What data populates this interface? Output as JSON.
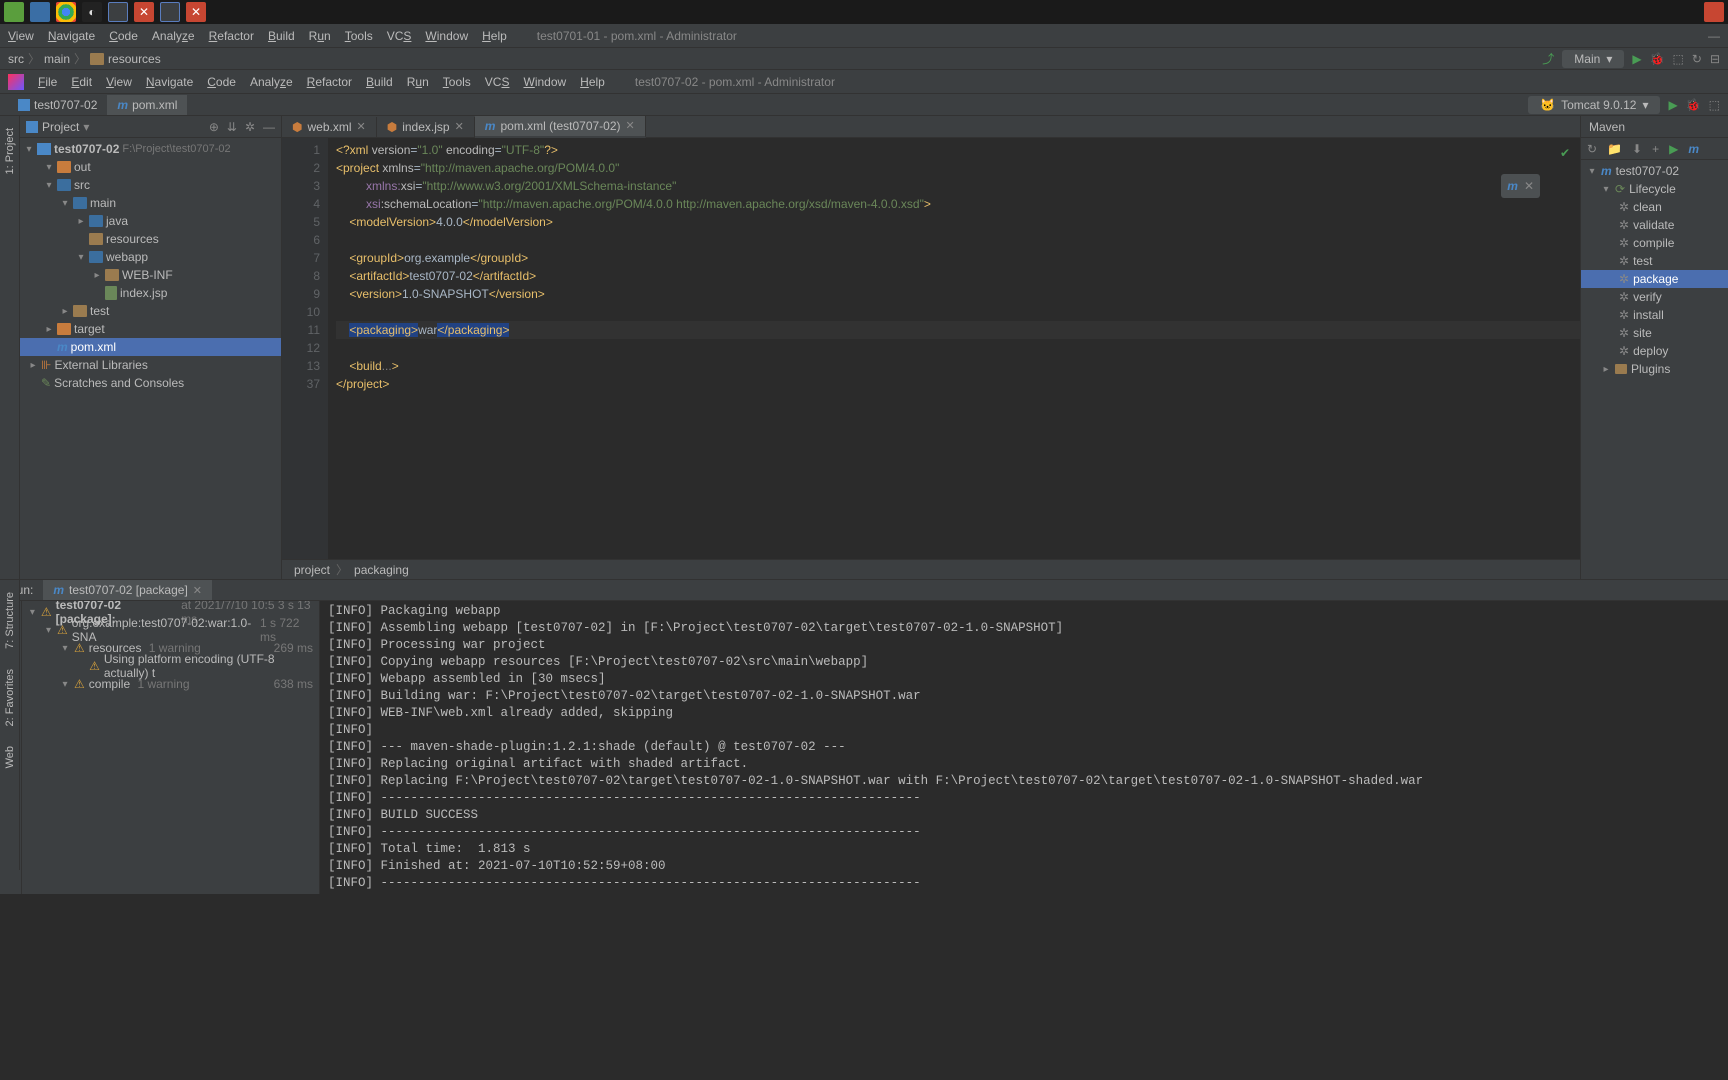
{
  "outer_menubar": {
    "items": [
      "View",
      "Navigate",
      "Code",
      "Analyze",
      "Refactor",
      "Build",
      "Run",
      "Tools",
      "VCS",
      "Window",
      "Help"
    ],
    "title": "test0701-01 - pom.xml - Administrator"
  },
  "outer_breadcrumb": {
    "parts": [
      "src",
      "main",
      "resources"
    ],
    "run_config": "Main"
  },
  "inner_menubar": {
    "items": [
      "File",
      "Edit",
      "View",
      "Navigate",
      "Code",
      "Analyze",
      "Refactor",
      "Build",
      "Run",
      "Tools",
      "VCS",
      "Window",
      "Help"
    ],
    "title": "test0707-02 - pom.xml - Administrator"
  },
  "outer_tabs": [
    {
      "label": "test0707-02",
      "active": false
    },
    {
      "label": "pom.xml",
      "active": true
    }
  ],
  "toolbar_right": {
    "run_config": "Tomcat 9.0.12"
  },
  "project": {
    "title": "Project",
    "root": {
      "name": "test0707-02",
      "path": "F:\\Project\\test0707-02"
    },
    "tree": [
      {
        "indent": 1,
        "arrow": "▾",
        "icon": "folder orange",
        "label": "out"
      },
      {
        "indent": 1,
        "arrow": "▾",
        "icon": "folder blue",
        "label": "src"
      },
      {
        "indent": 2,
        "arrow": "▾",
        "icon": "folder blue",
        "label": "main"
      },
      {
        "indent": 3,
        "arrow": "▸",
        "icon": "folder blue",
        "label": "java"
      },
      {
        "indent": 3,
        "arrow": "",
        "icon": "folder",
        "label": "resources"
      },
      {
        "indent": 3,
        "arrow": "▾",
        "icon": "folder blue",
        "label": "webapp"
      },
      {
        "indent": 4,
        "arrow": "▸",
        "icon": "folder",
        "label": "WEB-INF"
      },
      {
        "indent": 4,
        "arrow": "",
        "icon": "file",
        "label": "index.jsp"
      },
      {
        "indent": 2,
        "arrow": "▸",
        "icon": "folder",
        "label": "test"
      },
      {
        "indent": 1,
        "arrow": "▸",
        "icon": "folder orange",
        "label": "target"
      },
      {
        "indent": 1,
        "arrow": "",
        "icon": "file m",
        "label": "pom.xml",
        "highlighted": true
      },
      {
        "indent": 0,
        "arrow": "▸",
        "icon": "lib",
        "label": "External Libraries"
      },
      {
        "indent": 0,
        "arrow": "",
        "icon": "scratch",
        "label": "Scratches and Consoles"
      }
    ]
  },
  "editor_tabs": [
    {
      "label": "web.xml",
      "active": false
    },
    {
      "label": "index.jsp",
      "active": false
    },
    {
      "label": "pom.xml (test0707-02)",
      "active": true
    }
  ],
  "code": {
    "lines": [
      {
        "n": 1,
        "html": "<span class='tag'>&lt;?xml</span> <span class='attr'>version</span>=<span class='str'>\"1.0\"</span> <span class='attr'>encoding</span>=<span class='str'>\"UTF-8\"</span><span class='tag'>?&gt;</span>"
      },
      {
        "n": 2,
        "html": "<span class='tag'>&lt;project</span> <span class='attr'>xmlns</span>=<span class='str'>\"http://maven.apache.org/POM/4.0.0\"</span>"
      },
      {
        "n": 3,
        "html": "         <span class='ns'>xmlns:</span><span class='attr'>xsi</span>=<span class='str'>\"http://www.w3.org/2001/XMLSchema-instance\"</span>"
      },
      {
        "n": 4,
        "html": "         <span class='ns'>xsi</span><span class='attr'>:schemaLocation</span>=<span class='str'>\"http://maven.apache.org/POM/4.0.0 http://maven.apache.org/xsd/maven-4.0.0.xsd\"</span><span class='tag'>&gt;</span>"
      },
      {
        "n": 5,
        "html": "    <span class='tag'>&lt;modelVersion&gt;</span><span class='txt'>4.0.0</span><span class='tag'>&lt;/modelVersion&gt;</span>"
      },
      {
        "n": 6,
        "html": ""
      },
      {
        "n": 7,
        "html": "    <span class='tag'>&lt;groupId&gt;</span><span class='txt'>org.example</span><span class='tag'>&lt;/groupId&gt;</span>"
      },
      {
        "n": 8,
        "html": "    <span class='tag'>&lt;artifactId&gt;</span><span class='txt'>test0707-02</span><span class='tag'>&lt;/artifactId&gt;</span>"
      },
      {
        "n": 9,
        "html": "    <span class='tag'>&lt;version&gt;</span><span class='txt'>1.0-SNAPSHOT</span><span class='tag'>&lt;/version&gt;</span>"
      },
      {
        "n": 10,
        "html": ""
      },
      {
        "n": 11,
        "html": "    <span class='sel'><span class='tag'>&lt;packaging&gt;</span></span><span class='txt'>war</span><span class='sel'><span class='tag'>&lt;/packaging&gt;</span></span>",
        "hl": true
      },
      {
        "n": 12,
        "html": ""
      },
      {
        "n": 13,
        "html": "    <span class='tag'>&lt;build</span><span class='fold'>...</span><span class='tag'>&gt;</span>"
      },
      {
        "n": 37,
        "html": "<span class='tag'>&lt;/project&gt;</span>"
      }
    ]
  },
  "breadcrumb_bottom": [
    "project",
    "packaging"
  ],
  "maven": {
    "title": "Maven",
    "root": "test0707-02",
    "lifecycle_label": "Lifecycle",
    "items": [
      "clean",
      "validate",
      "compile",
      "test",
      "package",
      "verify",
      "install",
      "site",
      "deploy"
    ],
    "selected": "package",
    "plugins_label": "Plugins"
  },
  "run": {
    "label": "Run:",
    "tab": "test0707-02 [package]",
    "tree": {
      "root": {
        "label": "test0707-02 [package]:",
        "meta": "at 2021/7/10 10:5 3 s 13 ms"
      },
      "rows": [
        {
          "indent": 1,
          "label": "org.example:test0707-02:war:1.0-SNA",
          "meta": "1 s 722 ms"
        },
        {
          "indent": 2,
          "label": "resources",
          "warn": "1 warning",
          "meta": "269 ms"
        },
        {
          "indent": 3,
          "label": "Using platform encoding (UTF-8 actually) t",
          "meta": ""
        },
        {
          "indent": 2,
          "label": "compile",
          "warn": "1 warning",
          "meta": "638 ms"
        }
      ]
    },
    "console": [
      "[INFO] Packaging webapp",
      "[INFO] Assembling webapp [test0707-02] in [F:\\Project\\test0707-02\\target\\test0707-02-1.0-SNAPSHOT]",
      "[INFO] Processing war project",
      "[INFO] Copying webapp resources [F:\\Project\\test0707-02\\src\\main\\webapp]",
      "[INFO] Webapp assembled in [30 msecs]",
      "[INFO] Building war: F:\\Project\\test0707-02\\target\\test0707-02-1.0-SNAPSHOT.war",
      "[INFO] WEB-INF\\web.xml already added, skipping",
      "[INFO]",
      "[INFO] --- maven-shade-plugin:1.2.1:shade (default) @ test0707-02 ---",
      "[INFO] Replacing original artifact with shaded artifact.",
      "[INFO] Replacing F:\\Project\\test0707-02\\target\\test0707-02-1.0-SNAPSHOT.war with F:\\Project\\test0707-02\\target\\test0707-02-1.0-SNAPSHOT-shaded.war",
      "[INFO] ------------------------------------------------------------------------",
      "[INFO] BUILD SUCCESS",
      "[INFO] ------------------------------------------------------------------------",
      "[INFO] Total time:  1.813 s",
      "[INFO] Finished at: 2021-07-10T10:52:59+08:00",
      "[INFO] ------------------------------------------------------------------------"
    ]
  },
  "left_tools": [
    "1: Project",
    "7: Structure",
    "2: Favorites",
    "Web"
  ]
}
